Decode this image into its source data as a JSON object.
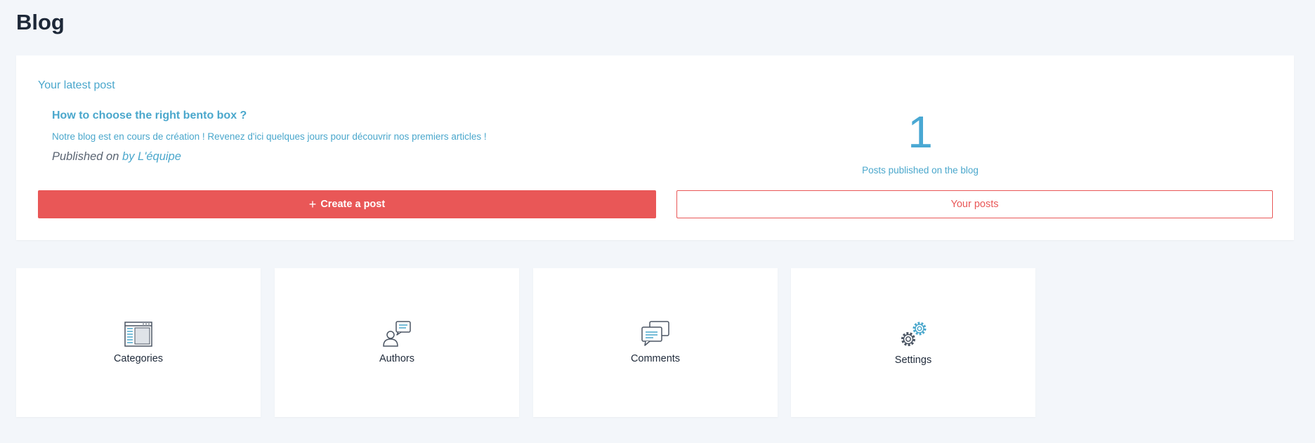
{
  "page": {
    "title": "Blog"
  },
  "latest": {
    "section_title": "Your latest post",
    "post_title": "How to choose the right bento box ?",
    "excerpt": "Notre blog est en cours de création ! Revenez d'ici quelques jours pour découvrir nos premiers articles !",
    "published_prefix": "Published on",
    "author": "by L'équipe"
  },
  "stats": {
    "count": "1",
    "label": "Posts published on the blog"
  },
  "actions": {
    "create_label": "Create a post",
    "create_icon": "+",
    "posts_label": "Your posts"
  },
  "tiles": [
    {
      "label": "Categories",
      "icon": "categories-icon"
    },
    {
      "label": "Authors",
      "icon": "authors-icon"
    },
    {
      "label": "Comments",
      "icon": "comments-icon"
    },
    {
      "label": "Settings",
      "icon": "settings-icon"
    }
  ],
  "colors": {
    "accent": "#4aa7cc",
    "primary_button": "#e95757",
    "background": "#f3f6fa",
    "card": "#ffffff",
    "heading": "#1d2838"
  }
}
